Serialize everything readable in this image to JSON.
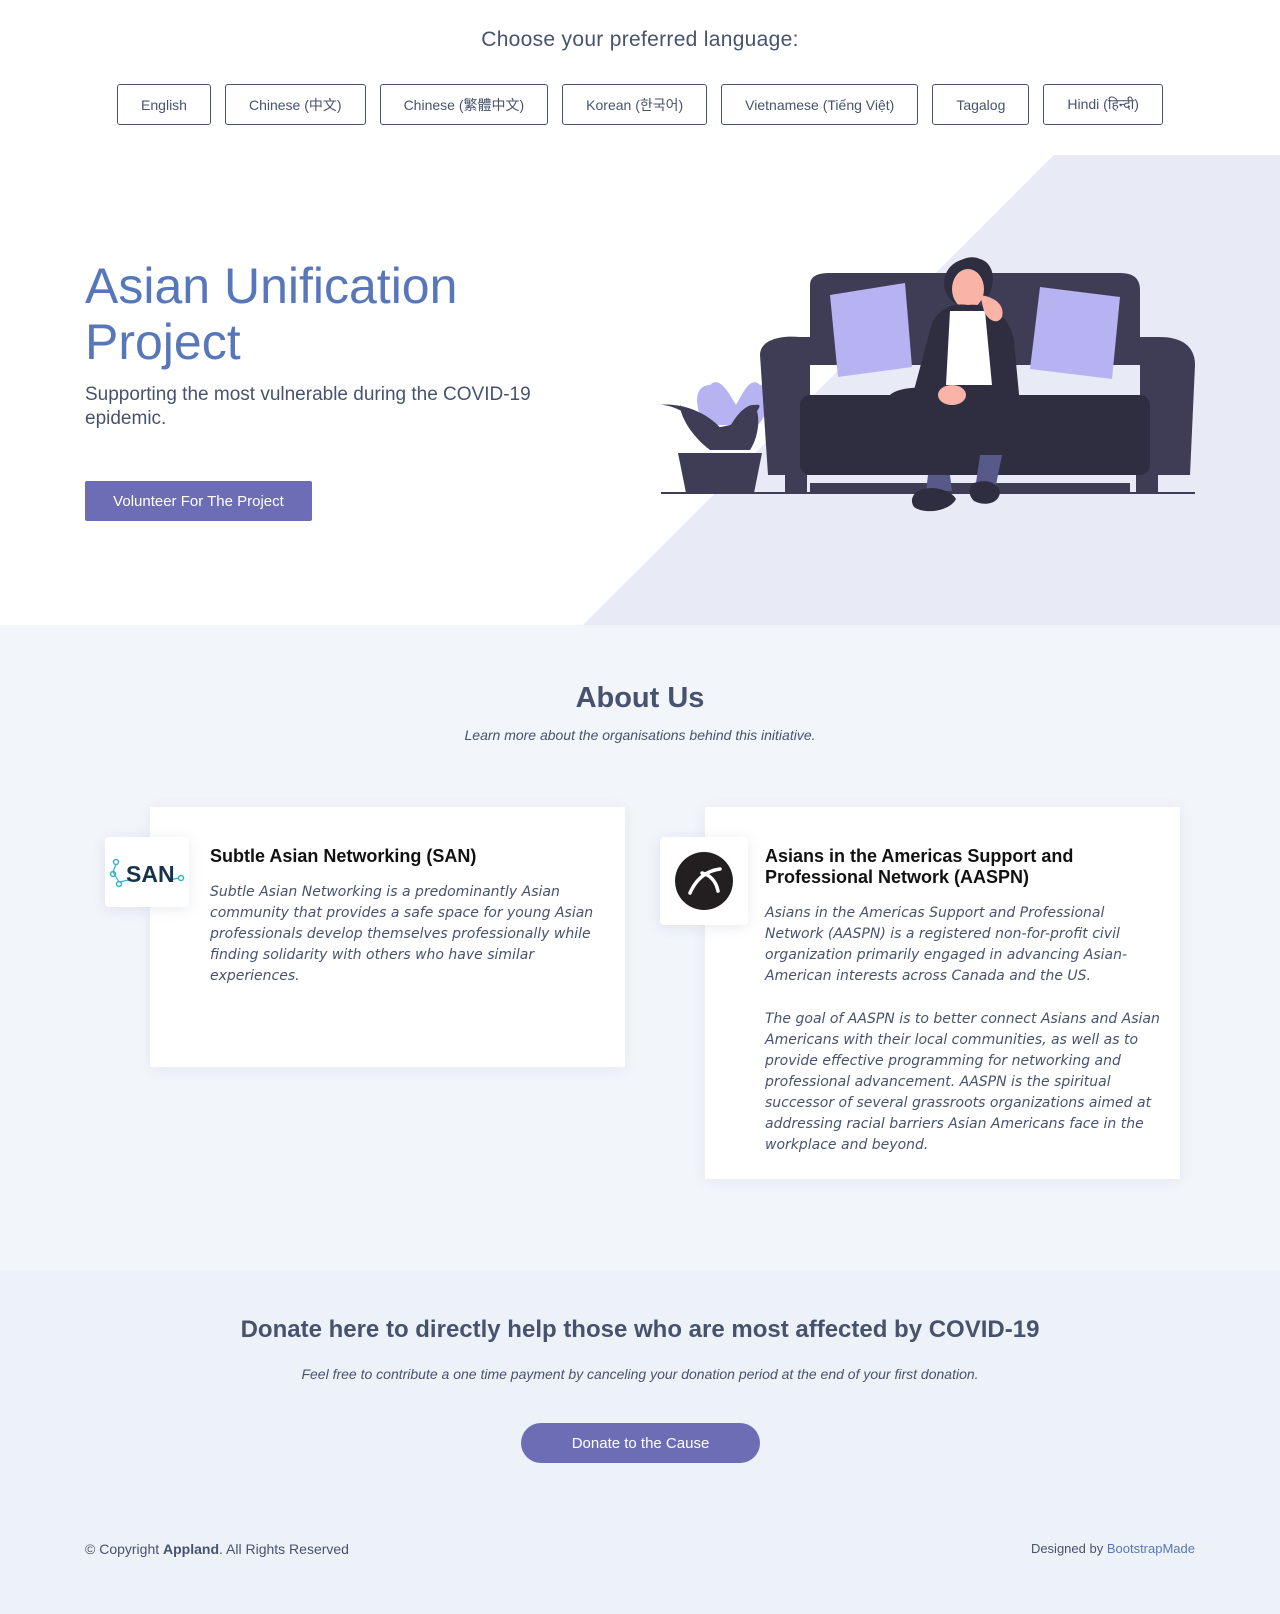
{
  "language_bar": {
    "title": "Choose your preferred language:",
    "languages": [
      "English",
      "Chinese (中文)",
      "Chinese (繁體中文)",
      "Korean (한국어)",
      "Vietnamese (Tiếng Việt)",
      "Tagalog",
      "Hindi (हिन्दी)"
    ]
  },
  "hero": {
    "title": "Asian Unification Project",
    "subtitle": "Supporting the most vulnerable during the COVID-19 epidemic.",
    "button": "Volunteer For The Project"
  },
  "about": {
    "title": "About Us",
    "subtitle": "Learn more about the organisations behind this initiative.",
    "cards": [
      {
        "logo_text": "SAN",
        "title": "Subtle Asian Networking (SAN)",
        "paragraphs": [
          "Subtle Asian Networking is a predominantly Asian community that provides a safe space for young Asian professionals develop themselves professionally while finding solidarity with others who have similar experiences."
        ]
      },
      {
        "title": "Asians in the Americas Support and Professional Network (AASPN)",
        "paragraphs": [
          "Asians in the Americas Support and Professional Network (AASPN) is a registered non-for-profit civil organization primarily engaged in advancing Asian-American interests across Canada and the US.",
          "The goal of AASPN is to better connect Asians and Asian Americans with their local communities, as well as to provide effective programming for networking and professional advancement. AASPN is the spiritual successor of several grassroots organizations aimed at addressing racial barriers Asian Americans face in the workplace and beyond."
        ]
      }
    ]
  },
  "donate": {
    "title": "Donate here to directly help those who are most affected by COVID-19",
    "subtitle": "Feel free to contribute a one time payment by canceling your donation period at the end of your first donation.",
    "button": "Donate to the Cause"
  },
  "footer": {
    "copyright_prefix": "© Copyright ",
    "brand": "Appland",
    "copyright_suffix": ". All Rights Reserved",
    "designed_prefix": "Designed by ",
    "designed_link": "BootstrapMade"
  },
  "colors": {
    "accent": "#6c6db4",
    "title_blue": "#5777ba",
    "text": "#47536e",
    "hero_panel": "#e8ebf5",
    "about_bg": "#f2f5fa"
  },
  "icons": [
    "couch-illustration",
    "plant-illustration",
    "person-illustration",
    "san-logo",
    "aaspn-logo"
  ]
}
